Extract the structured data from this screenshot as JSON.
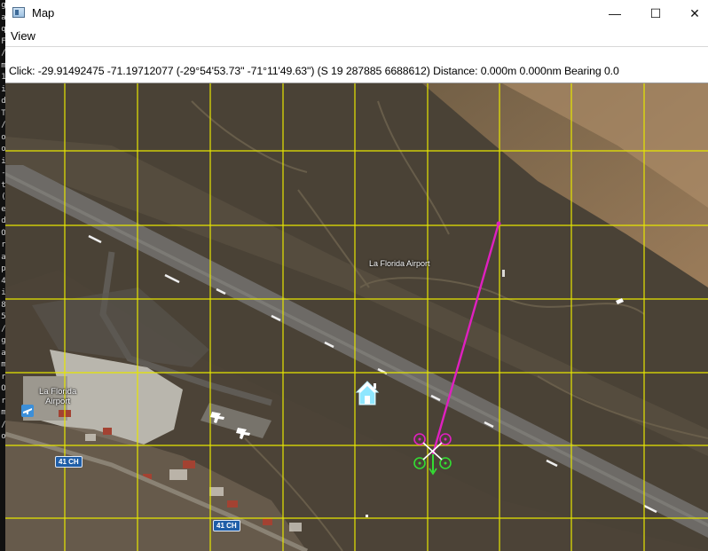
{
  "window": {
    "title": "Map"
  },
  "titlebar": {
    "minimize": "—",
    "maximize": "☐",
    "close": "✕"
  },
  "menu": {
    "view": "View"
  },
  "status": {
    "text": "Click: -29.91492475 -71.19712077 (-29°54'53.73\" -71°11'49.63\") (S 19 287885 6688612)  Distance: 0.000m 0.000nm Bearing 0.0"
  },
  "map": {
    "airport_label_center": "La Florida Airport",
    "airport_label_left_line1": "La Florida",
    "airport_label_left_line2": "Airport",
    "route_badge_1": "41 CH",
    "route_badge_2": "41 CH",
    "grid_color": "#e6e600",
    "route_color": "#e020c0",
    "home_icon": "home-icon",
    "drone_icon": "quadcopter-icon"
  },
  "left_terminal": {
    "chars": [
      "g",
      "a",
      "q",
      "F",
      "/",
      "m",
      "1",
      "i",
      "d",
      "T",
      "/",
      "o",
      "o",
      "i",
      "-",
      "t",
      "(",
      "e",
      "d",
      "O",
      "r",
      "a",
      "p",
      "4",
      "i",
      "8",
      "5",
      "/",
      "g",
      "a",
      "m",
      "r",
      "O",
      "r",
      "m",
      "/",
      "o"
    ]
  }
}
